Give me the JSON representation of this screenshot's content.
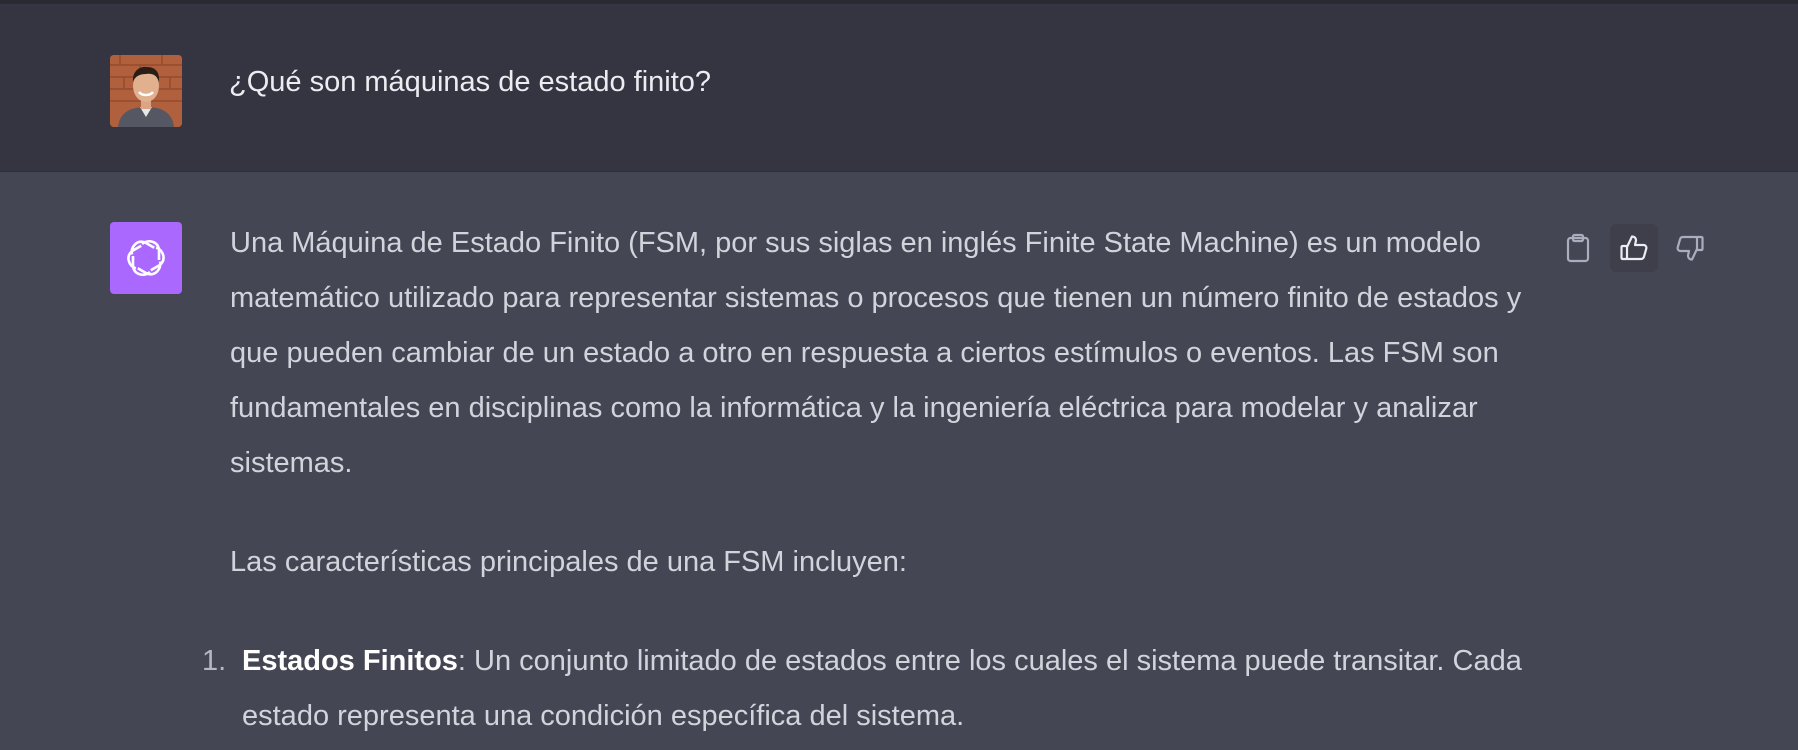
{
  "user_message": {
    "text": "¿Qué son máquinas de estado finito?"
  },
  "assistant_message": {
    "paragraph_1": "Una Máquina de Estado Finito (FSM, por sus siglas en inglés Finite State Machine) es un modelo matemático utilizado para representar sistemas o procesos que tienen un número finito de estados y que pueden cambiar de un estado a otro en respuesta a ciertos estímulos o eventos. Las FSM son fundamentales en disciplinas como la informática y la ingeniería eléctrica para modelar y analizar sistemas.",
    "paragraph_2": "Las características principales de una FSM incluyen:",
    "list": [
      {
        "number": "1.",
        "title": "Estados Finitos",
        "body": ": Un conjunto limitado de estados entre los cuales el sistema puede transitar. Cada estado representa una condición específica del sistema."
      }
    ]
  },
  "actions": {
    "copy_icon": "clipboard-icon",
    "like_icon": "thumbs-up-icon",
    "dislike_icon": "thumbs-down-icon"
  },
  "colors": {
    "user_bg": "#343541",
    "assistant_bg": "#444654",
    "ai_avatar": "#ab68ff",
    "text": "#d1d5db"
  }
}
